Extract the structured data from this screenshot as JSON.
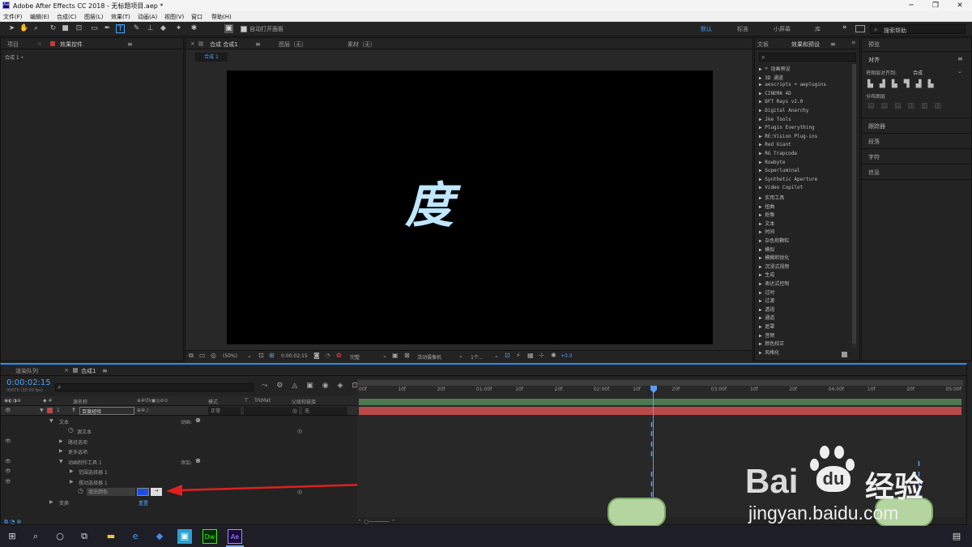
{
  "window": {
    "title": "Adobe After Effects CC 2018 - 无标题项目.aep *",
    "ae_badge": "Ae",
    "min": "─",
    "max": "❐",
    "close": "✕"
  },
  "menu": [
    "文件(F)",
    "编辑(E)",
    "合成(C)",
    "图层(L)",
    "效果(T)",
    "动画(A)",
    "视图(V)",
    "窗口",
    "帮助(H)"
  ],
  "toolbar": {
    "auto_open": "自动打开面板",
    "workspaces": [
      "默认",
      "标准",
      "小屏幕",
      "库"
    ],
    "more": "»",
    "search_placeholder": "搜索帮助"
  },
  "project_panel": {
    "tab_project": "项目",
    "tab_effect_controls": "效果控件",
    "breadcrumb": "合成 1 •"
  },
  "comp_panel": {
    "tab": "合成 合成1",
    "tab_layer": "图层（无）",
    "tab_footage": "素材（无）",
    "sub_tab": "合成 1",
    "glyph": "度",
    "zoom": "(50%)",
    "timecode": "0:00:02:15",
    "quality": "完整",
    "camera": "活动摄像机",
    "views": "1个...",
    "exposure": "+0.0"
  },
  "effects_panel": {
    "tab_info": "文板",
    "tab_effects": "效果和预设",
    "items": [
      "▶ * 动画预设",
      "▶ 3D 通道",
      "▶ aescripts + aeplugins",
      "▶ CINEMA 4D",
      "▶ DFT Rays v2.0",
      "▶ Digital Anarchy",
      "▶ Jke Tools",
      "▶ Plugin Everything",
      "▶ RE:Vision Plug-ins",
      "▶ Red Giant",
      "▶ RG Trapcode",
      "▶ Rowbyte",
      "▶ Superluminal",
      "▶ Synthetic Aperture",
      "▶ Video Copilot",
      "▶ 实用工具",
      "▶ 扭曲",
      "▶ 抠像",
      "▶ 文本",
      "▶ 时间",
      "▶ 杂色和颗粒",
      "▶ 模拟",
      "▶ 模糊和锐化",
      "▶ 沉浸式视频",
      "▶ 生成",
      "▶ 表达式控制",
      "▶ 过时",
      "▶ 过渡",
      "▶ 透视",
      "▶ 通道",
      "▶ 遮罩",
      "▶ 音频",
      "▶ 颜色校正",
      "▶ 风格化"
    ]
  },
  "right_panel": {
    "preview": "预览",
    "align": "对齐",
    "align_to_label": "将图层对齐到:",
    "align_to": "合成",
    "distribute": "分布图层",
    "tracker": "跟踪器",
    "paragraph": "段落",
    "character": "字符",
    "info": "信息"
  },
  "timeline": {
    "tab_render": "渲染队列",
    "tab_comp": "合成1",
    "timecode": "0:00:02:15",
    "fps": "00075 (30.00 fps)",
    "col_layer_name": "源名称",
    "col_mode": "模式",
    "col_trkmat": "TrkMat",
    "col_parent": "父级和链接",
    "ruler": [
      "00f",
      "10f",
      "20f",
      "01:00f",
      "10f",
      "20f",
      "02:00f",
      "10f",
      "20f",
      "03:00f",
      "10f",
      "20f",
      "04:00f",
      "10f",
      "20f",
      "05:00f"
    ],
    "layer": {
      "num": "1",
      "name": "百度经验",
      "mode": "正常",
      "parent": "无"
    },
    "rows": {
      "text": "文本",
      "animate": "动画:",
      "source_text": "源文本",
      "path_options": "路径选项",
      "more_options": "更多选项",
      "animator": "动画制作工具 1",
      "add": "添加:",
      "range_selector": "范围选择器 1",
      "wiggly_selector": "摆动选择器 1",
      "fill_color": "填充颜色",
      "transform": "变换",
      "reset": "重置"
    }
  },
  "watermark": {
    "brand": "Bai",
    "paw": "du",
    "cn": "经验",
    "url": "jingyan.baidu.com"
  },
  "colors": {
    "accent": "#2d8ceb",
    "layer_bar": "#b84a4a",
    "fill_swatch": "#1a4fe6",
    "arrow": "#e02020",
    "glyph": "#bfe7ff"
  },
  "taskbar": [
    "windows-icon",
    "search-icon",
    "cortana-icon",
    "taskview-icon",
    "explorer-icon",
    "edge-icon",
    "app-icon",
    "app2-icon",
    "dreamweaver-icon",
    "aftereffects-icon"
  ]
}
